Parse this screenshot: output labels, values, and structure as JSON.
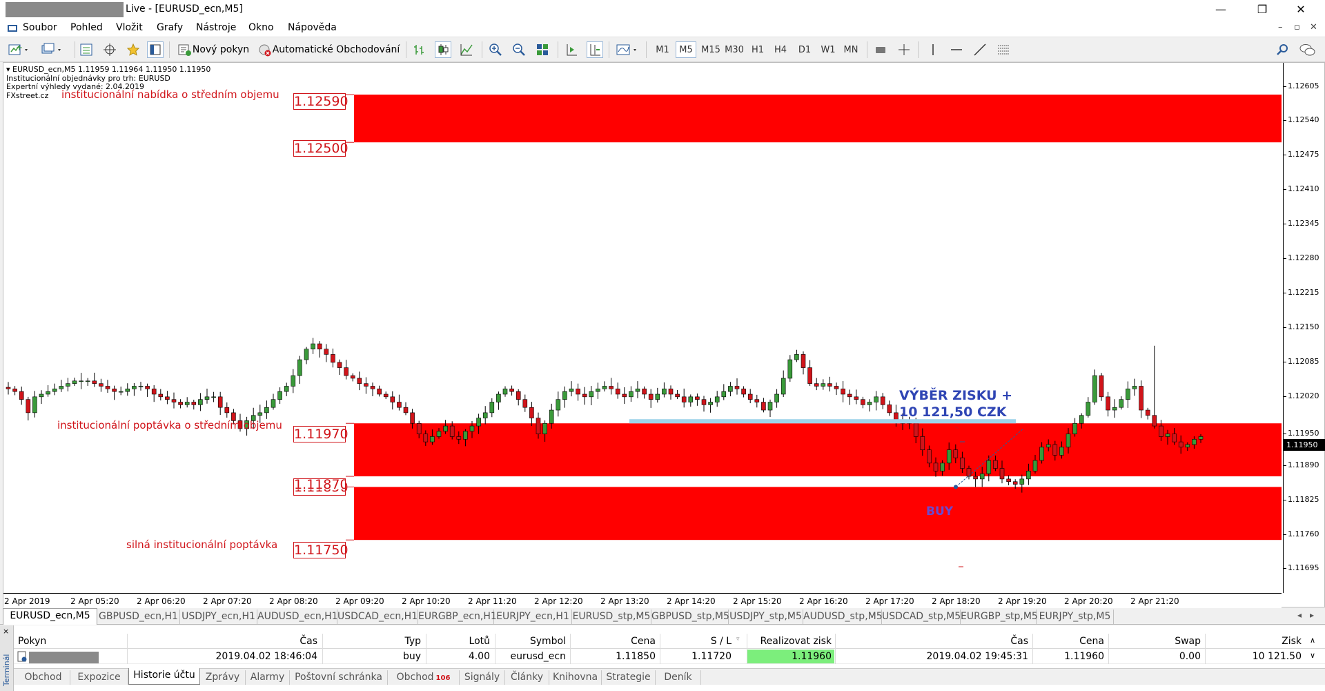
{
  "window": {
    "title": "Live - [EURUSD_ecn,M5]",
    "controls": {
      "minimize": "—",
      "restore": "❐",
      "close": "✕"
    }
  },
  "menu": {
    "items": [
      "Soubor",
      "Pohled",
      "Vložit",
      "Grafy",
      "Nástroje",
      "Okno",
      "Nápověda"
    ],
    "mdi": {
      "min": "–",
      "restore": "▫",
      "close": "✕"
    }
  },
  "toolbar": {
    "new_order": "Nový pokyn",
    "auto_trading": "Automatické Obchodování",
    "timeframes": [
      "M1",
      "M5",
      "M15",
      "M30",
      "H1",
      "H4",
      "D1",
      "W1",
      "MN"
    ],
    "active_timeframe": "M5"
  },
  "chart": {
    "info_lines": [
      "EURUSD_ecn,M5  1.11959 1.11964 1.11950 1.11950",
      "Institucionální objednávky pro trh: EURUSD",
      "Expertní výhledy vydané: 2.04.2019",
      "FXstreet.cz"
    ],
    "zone_labels": {
      "supply_mid": "institucionální nabídka o středním objemu",
      "demand_mid": "institucionální poptávka o středním objemu",
      "demand_strong": "silná institucionální poptávka"
    },
    "price_boxes": [
      "1.12590",
      "1.12500",
      "1.11970",
      "1.11870",
      "1.11850",
      "1.11750"
    ],
    "annotation_line1": "VÝBĚR ZISKU +",
    "annotation_line2": "10 121,50 CZK",
    "buy_label": "BUY",
    "price_axis": [
      "1.12605",
      "1.12540",
      "1.12475",
      "1.12410",
      "1.12345",
      "1.12280",
      "1.12215",
      "1.12150",
      "1.12085",
      "1.12020",
      "1.11950",
      "1.11890",
      "1.11825",
      "1.11760",
      "1.11695"
    ],
    "current_price": "1.11950",
    "time_axis": [
      "2 Apr 2019",
      "2 Apr 05:20",
      "2 Apr 06:20",
      "2 Apr 07:20",
      "2 Apr 08:20",
      "2 Apr 09:20",
      "2 Apr 10:20",
      "2 Apr 11:20",
      "2 Apr 12:20",
      "2 Apr 13:20",
      "2 Apr 14:20",
      "2 Apr 15:20",
      "2 Apr 16:20",
      "2 Apr 17:20",
      "2 Apr 18:20",
      "2 Apr 19:20",
      "2 Apr 20:20",
      "2 Apr 21:20"
    ],
    "colors": {
      "zone": "#ff0000",
      "label": "#d0141a",
      "bull_candle": "#3a9a3a",
      "bear_candle": "#d0141a",
      "target_line": "#9ed3ea",
      "annotation": "#2f45b4"
    }
  },
  "chart_data": {
    "type": "candlestick",
    "symbol": "EURUSD_ecn",
    "timeframe": "M5",
    "ylim": [
      1.1165,
      1.1265
    ],
    "zones": [
      {
        "low": 1.125,
        "high": 1.1259
      },
      {
        "low": 1.1187,
        "high": 1.1197
      },
      {
        "low": 1.1175,
        "high": 1.1185
      }
    ],
    "close": [
      1.12035,
      1.1203,
      1.12015,
      1.1199,
      1.1202,
      1.12025,
      1.1203,
      1.12035,
      1.1204,
      1.12045,
      1.1205,
      1.1205,
      1.1205,
      1.12045,
      1.1204,
      1.12035,
      1.1203,
      1.1203,
      1.12035,
      1.1204,
      1.1204,
      1.12035,
      1.12025,
      1.1202,
      1.12015,
      1.1201,
      1.12005,
      1.1201,
      1.12005,
      1.12015,
      1.1202,
      1.1202,
      1.12,
      1.1199,
      1.11975,
      1.1196,
      1.11975,
      1.11985,
      1.1199,
      1.12,
      1.12015,
      1.1203,
      1.1204,
      1.1206,
      1.1209,
      1.1211,
      1.1212,
      1.1211,
      1.121,
      1.12085,
      1.12075,
      1.1206,
      1.12055,
      1.12045,
      1.1204,
      1.12035,
      1.12025,
      1.1202,
      1.1201,
      1.12,
      1.1199,
      1.1197,
      1.1195,
      1.11935,
      1.11945,
      1.11955,
      1.11965,
      1.11945,
      1.1194,
      1.11955,
      1.11965,
      1.1198,
      1.1199,
      1.1201,
      1.12025,
      1.12035,
      1.1203,
      1.12015,
      1.12,
      1.1198,
      1.1195,
      1.1197,
      1.11995,
      1.12015,
      1.1203,
      1.12035,
      1.12025,
      1.1202,
      1.1203,
      1.12035,
      1.1204,
      1.12035,
      1.12025,
      1.1202,
      1.1203,
      1.12035,
      1.12025,
      1.12015,
      1.12025,
      1.12035,
      1.12025,
      1.1202,
      1.1201,
      1.1202,
      1.12015,
      1.12005,
      1.1201,
      1.1202,
      1.1203,
      1.1204,
      1.12035,
      1.12025,
      1.12015,
      1.1201,
      1.11995,
      1.1201,
      1.12025,
      1.12055,
      1.1209,
      1.121,
      1.12075,
      1.12045,
      1.1204,
      1.12045,
      1.1204,
      1.12035,
      1.12025,
      1.1202,
      1.12015,
      1.12005,
      1.1201,
      1.1202,
      1.12005,
      1.1199,
      1.11975,
      1.1197,
      1.11975,
      1.11945,
      1.1192,
      1.11895,
      1.1188,
      1.11895,
      1.1192,
      1.11905,
      1.11885,
      1.1187,
      1.11865,
      1.11875,
      1.119,
      1.11885,
      1.11865,
      1.1186,
      1.11855,
      1.11865,
      1.1188,
      1.119,
      1.11925,
      1.1193,
      1.1191,
      1.11925,
      1.1195,
      1.1197,
      1.11985,
      1.1201,
      1.1206,
      1.1202,
      1.11995,
      1.12,
      1.12015,
      1.12035,
      1.1204,
      1.11995,
      1.11985,
      1.11965,
      1.11945,
      1.1195,
      1.11935,
      1.11925,
      1.1193,
      1.1194,
      1.11945
    ],
    "target_line": {
      "price": 1.1197
    },
    "open_position": {
      "type": "buy",
      "open": 1.1185,
      "take_profit": 1.1196
    }
  },
  "symbol_tabs": [
    "EURUSD_ecn,M5",
    "GBPUSD_ecn,H1",
    "USDJPY_ecn,H1",
    "AUDUSD_ecn,H1",
    "USDCAD_ecn,H1",
    "EURGBP_ecn,H1",
    "EURJPY_ecn,H1",
    "EURUSD_stp,M5",
    "GBPUSD_stp,M5",
    "USDJPY_stp,M5",
    "AUDUSD_stp,M5",
    "USDCAD_stp,M5",
    "EURGBP_stp,M5",
    "EURJPY_stp,M5"
  ],
  "terminal": {
    "side_label": "Terminál",
    "close": "×",
    "columns": {
      "order": "Pokyn",
      "time": "Čas",
      "type": "Typ",
      "lots": "Lotů",
      "symbol": "Symbol",
      "price": "Cena",
      "sl": "S / L",
      "tp": "Realizovat zisk",
      "time2": "Čas",
      "price2": "Cena",
      "swap": "Swap",
      "profit": "Zisk"
    },
    "row": {
      "time": "2019.04.02 18:46:04",
      "type": "buy",
      "lots": "4.00",
      "symbol": "eurusd_ecn",
      "price": "1.11850",
      "sl": "1.11720",
      "tp": "1.11960",
      "time2": "2019.04.02 19:45:31",
      "price2": "1.11960",
      "swap": "0.00",
      "profit": "10 121.50"
    },
    "tabs": [
      "Obchod",
      "Expozice",
      "Historie účtu",
      "Zprávy",
      "Alarmy",
      "Poštovní schránka",
      "Obchod",
      "Signály",
      "Články",
      "Knihovna",
      "Strategie",
      "Deník"
    ],
    "active_tab": "Historie účtu",
    "market_badge": "106"
  }
}
